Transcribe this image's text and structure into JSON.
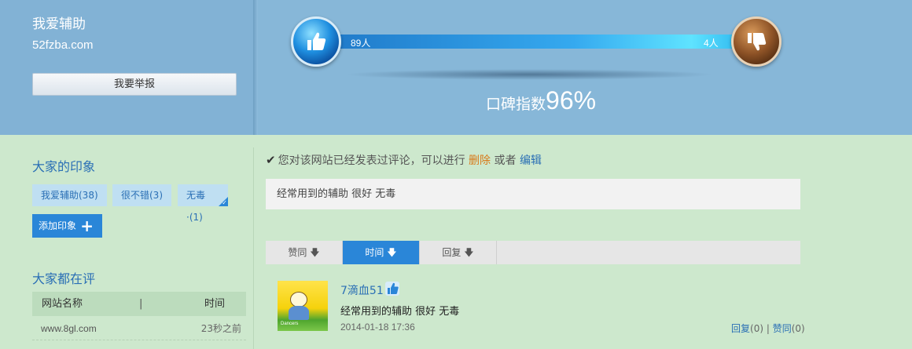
{
  "site": {
    "name": "我爱辅助",
    "domain": "52fzba.com",
    "report_label": "我要举报"
  },
  "votes": {
    "like_count": "89人",
    "dislike_count": "4人",
    "like_fraction": 0.957,
    "rating_label": "口碑指数",
    "rating_value": "96%"
  },
  "impressions": {
    "title": "大家的印象",
    "tags": [
      {
        "label": "我爱辅助(38)"
      },
      {
        "label": "很不错(3)"
      },
      {
        "label": "无毒·(1)",
        "selected": true
      }
    ],
    "add_label": "添加印象"
  },
  "recent": {
    "title": "大家都在评",
    "col_name": "网站名称",
    "col_sep": "|",
    "col_time": "时间",
    "rows": [
      {
        "site": "www.8gl.com",
        "time": "23秒之前"
      }
    ]
  },
  "notice": {
    "text": "您对该网站已经发表过评论，可以进行",
    "delete_label": "删除",
    "or_label": "或者",
    "edit_label": "编辑"
  },
  "my_review": "经常用到的辅助 很好 无毒",
  "sort_tabs": [
    {
      "label": "赞同",
      "arrow": "🡇"
    },
    {
      "label": "时间",
      "arrow": "🡇",
      "active": true
    },
    {
      "label": "回复",
      "arrow": "🡇"
    }
  ],
  "comment": {
    "user": "7滴血51",
    "text": "经常用到的辅助 很好 无毒",
    "date": "2014-01-18 17:36",
    "reply_label": "回复",
    "reply_count": "(0)",
    "sep": "|",
    "agree_label": "赞同",
    "agree_count": "(0)",
    "avatar_text": "Dancers"
  },
  "colors": {
    "top_bg": "#87b7d8",
    "page_bg": "#cde8cd",
    "accent": "#2a86d8",
    "link": "#2a6fb5",
    "delete": "#d87a1a"
  },
  "icons": [
    "thumbs-up-icon",
    "thumbs-down-icon",
    "plus-icon",
    "check-icon",
    "sort-arrow-icon"
  ]
}
